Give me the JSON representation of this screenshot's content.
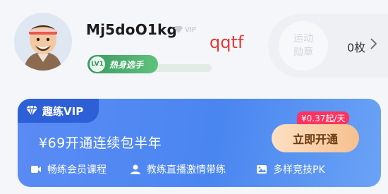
{
  "profile": {
    "username": "Mj5doO1kg",
    "vip_chip_label": "VIP",
    "level_badge": {
      "icon_label": "LV1",
      "title": "热身选手"
    },
    "level_progress": 0.0
  },
  "overlay_text": "qqtf",
  "medal": {
    "label_line1": "运动",
    "label_line2": "勋章",
    "count": "0枚"
  },
  "vip_card": {
    "tab_label": "趣练VIP",
    "headline": "¥69开通连续包半年",
    "price_tag": "¥0.37起/天",
    "cta_label": "立即开通",
    "benefits": [
      {
        "icon": "video-camera-icon",
        "label": "畅练会员课程"
      },
      {
        "icon": "person-icon",
        "label": "教练直播激情带练"
      },
      {
        "icon": "image-icon",
        "label": "多样竞技PK"
      }
    ]
  },
  "colors": {
    "vip_card_gradient_start": "#5b8bf5",
    "vip_tab": "#2d5fd6",
    "cta_gradient_start": "#fde0c3",
    "price_tag": "#ff3360",
    "level_badge": "#3a9a62"
  }
}
